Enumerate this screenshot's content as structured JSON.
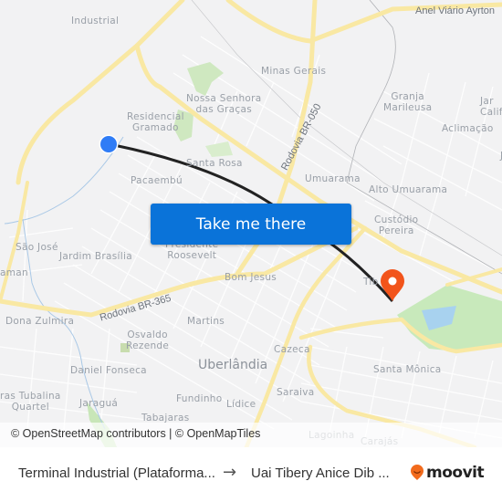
{
  "map": {
    "labels": {
      "industrial": "Industrial",
      "anel_viario": "Anel Viário Ayrton",
      "minas_gerais": "Minas Gerais",
      "nossa_senhora": "Nossa Senhora\ndas Graças",
      "residencial_gramado": "Residencial\nGramado",
      "granja_marileusa": "Granja\nMarileusa",
      "jardim_california": "Jar\nCalif",
      "aclimacao": "Aclimação",
      "santa_rosa": "Santa Rosa",
      "rodovia_br050": "Rodovia BR-050",
      "umuarama": "Umuarama",
      "alto_umuarama": "Alto Umuarama",
      "pacaembu": "Pacaembú",
      "custodio_pereira": "Custódio\nPereira",
      "sao_jose": "São José",
      "jardim_brasilia": "Jardim Brasília",
      "presidente_roosevelt": "Presidente\nRoosevelt",
      "bom_jesus": "Bom Jesus",
      "aman": "aman",
      "tibery": "Tib",
      "rodovia_br365": "Rodovia BR-365",
      "dona_zulmira": "Dona Zulmira",
      "martins": "Martins",
      "osvaldo_rezende": "Osvaldo\nRezende",
      "cazeca": "Cazeca",
      "uberlandia": "Uberlândia",
      "daniel_fonseca": "Daniel Fonseca",
      "santa_monica": "Santa Mônica",
      "tubalina": "ras Tubalina\nQuartel",
      "jaragua": "Jaraguá",
      "fundinho": "Fundinho",
      "lidice": "Lídice",
      "saraiva": "Saraiva",
      "tabajaras": "Tabajaras",
      "lagoinha": "Lagoinha",
      "carajas": "Carajás",
      "j_right": "J"
    },
    "origin_marker_color": "#2f7cf6",
    "destination_marker_color": "#f2541b",
    "route_color": "#222222"
  },
  "cta": {
    "take_me_there": "Take me there",
    "color": "#0a73d9"
  },
  "attribution": {
    "text": "© OpenStreetMap contributors | © OpenMapTiles"
  },
  "footer": {
    "from": "Terminal Industrial (Plataforma...",
    "arrow": "→",
    "to": "Uai Tibery Anice Dib ...",
    "brand": "moovit",
    "brand_color": "#f26b1d"
  }
}
